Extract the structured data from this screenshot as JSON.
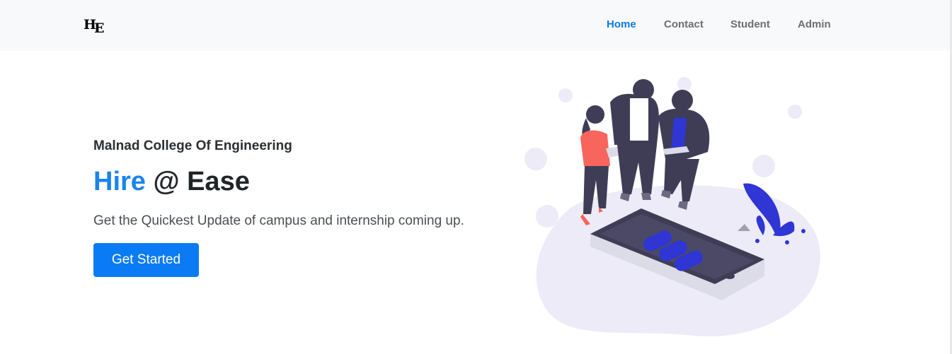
{
  "navbar": {
    "logo_part1": "H",
    "logo_part2": "E",
    "links": [
      {
        "label": "Home",
        "active": true
      },
      {
        "label": "Contact",
        "active": false
      },
      {
        "label": "Student",
        "active": false
      },
      {
        "label": "Admin",
        "active": false
      }
    ]
  },
  "hero": {
    "subtitle": "Malnad College Of Engineering",
    "headline_accent": "Hire",
    "headline_rest": " @ Ease",
    "lead": "Get the Quickest Update of campus and internship coming up.",
    "cta_label": "Get Started"
  },
  "colors": {
    "accent": "#0a7bf5",
    "nav_active": "#0d7ae6",
    "illustration_primary": "#3f3d56",
    "illustration_accent": "#2f36d4"
  },
  "icons": {
    "hero_illustration": "team-with-smartphone-illustration"
  }
}
